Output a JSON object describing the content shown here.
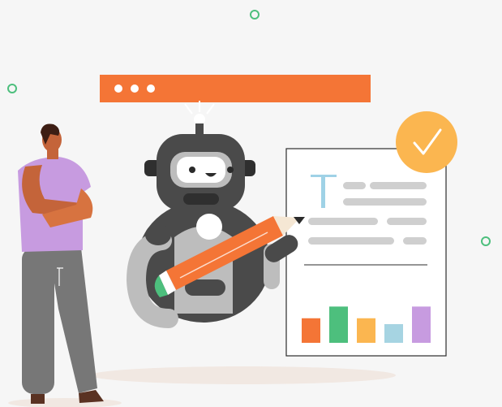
{
  "colors": {
    "background": "#f6f6f6",
    "accent_orange": "#f47536",
    "check_badge": "#fbb650",
    "deco_ring": "#4dbf7d",
    "robot_dark": "#4a4a4a",
    "robot_gray": "#b9b9b9",
    "person_shirt": "#c79be0",
    "person_pants": "#777777",
    "person_skin": "#c4643a",
    "bar_colors": [
      "#f47536",
      "#4dbf7d",
      "#fbb650",
      "#a6d4e2",
      "#c79be0"
    ]
  },
  "icons": {
    "check": "check-icon",
    "text_format": "text-t-icon",
    "pencil": "pencil-icon"
  },
  "document_bar_levels": [
    0.42,
    0.62,
    0.42,
    0.32,
    0.62
  ]
}
